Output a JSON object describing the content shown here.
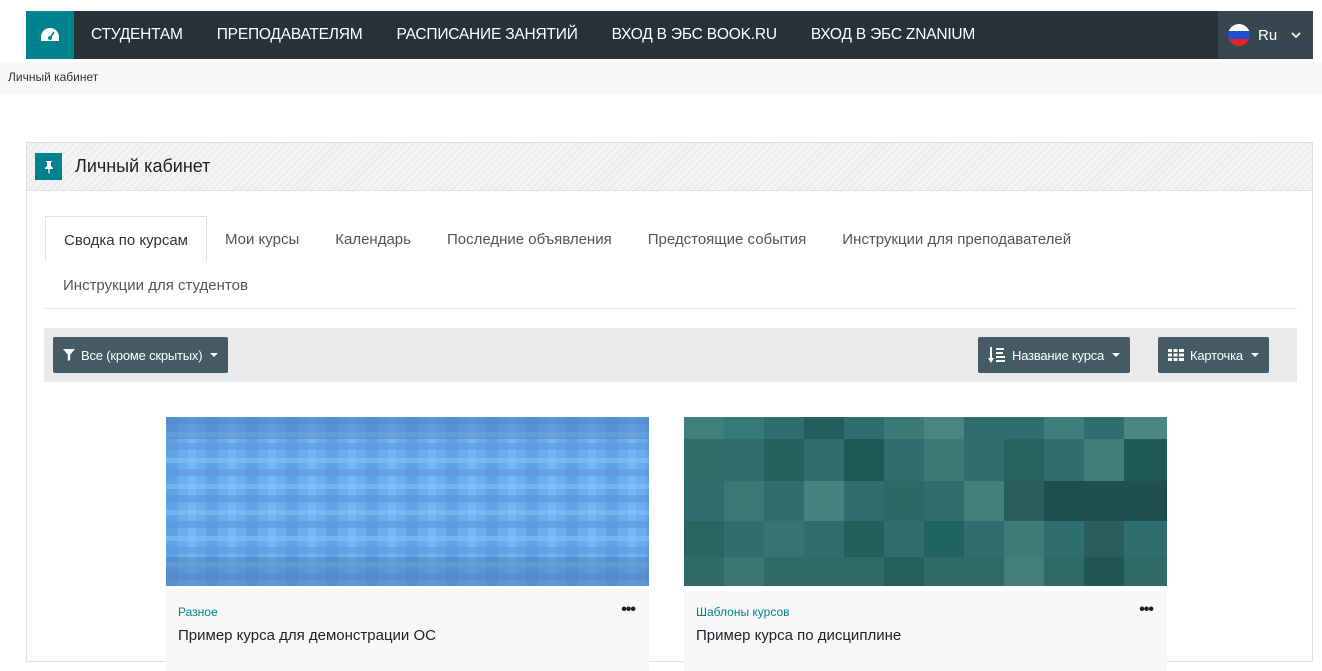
{
  "navbar": {
    "home_icon": "dashboard-icon",
    "links": [
      "СТУДЕНТАМ",
      "ПРЕПОДАВАТЕЛЯМ",
      "РАСПИСАНИЕ ЗАНЯТИЙ",
      "ВХОД В ЭБС BOOK.RU",
      "ВХОД В ЭБС ZNANIUM"
    ],
    "lang": "Ru"
  },
  "breadcrumb": "Личный кабинет",
  "block": {
    "title": "Личный кабинет",
    "icon": "pin-icon",
    "tabs": [
      "Сводка по курсам",
      "Мои курсы",
      "Календарь",
      "Последние объявления",
      "Предстоящие события",
      "Инструкции для преподавателей",
      "Инструкции для студентов"
    ]
  },
  "filters": {
    "grouping": "Все (кроме скрытых)",
    "sort": "Название курса",
    "view": "Карточка"
  },
  "courses": [
    {
      "category": "Разное",
      "name": "Пример курса для демонстрации ОС"
    },
    {
      "category": "Шаблоны курсов",
      "name": "Пример курса по дисциплине"
    }
  ],
  "colors": {
    "navbar": "#263238",
    "accent": "#00838f",
    "button": "#455a64"
  }
}
